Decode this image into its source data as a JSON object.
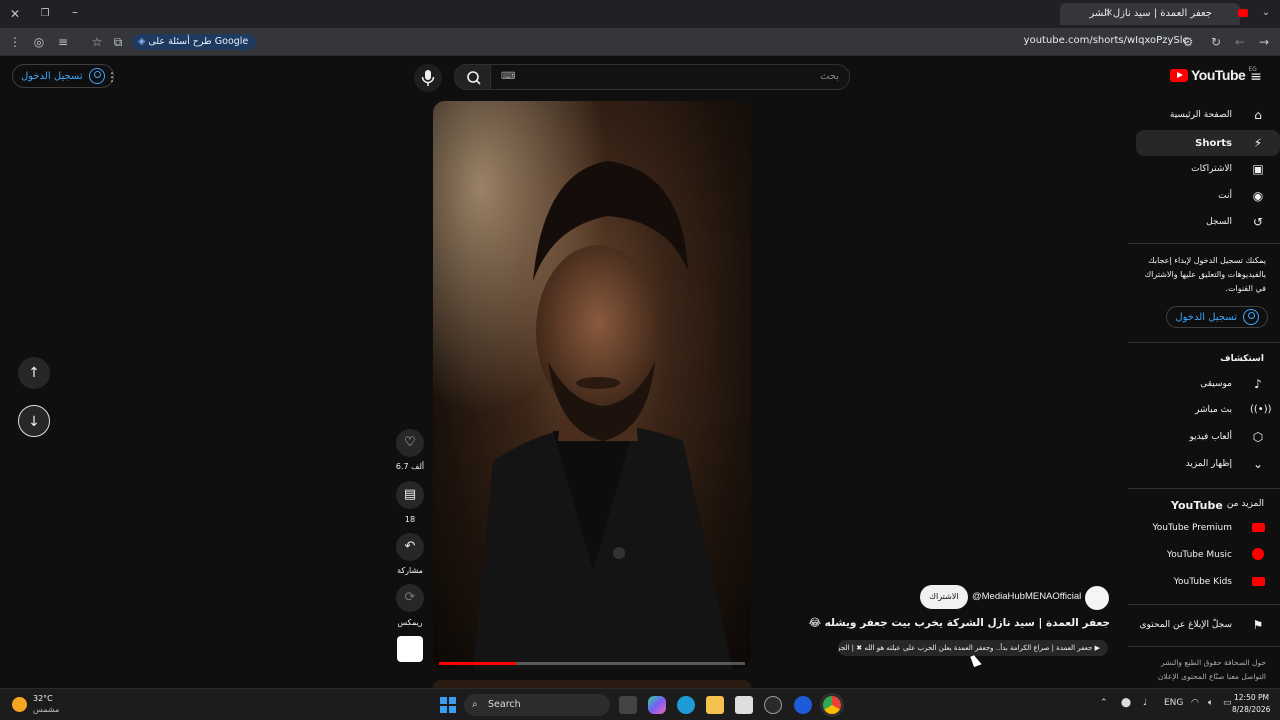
{
  "browser": {
    "tab_title": "جعفر العمدة | سيد نازل الشر",
    "chip_label": "طرح أسئلة على Google",
    "url": "youtube.com/shorts/wIqxoPzySlc"
  },
  "header": {
    "logo_text": "YouTube",
    "region": "EG",
    "search_placeholder": "بحث",
    "signin_label": "تسجيل الدخول"
  },
  "sidebar": {
    "items": [
      {
        "label": "الصفحة الرئيسية",
        "icon": "home-icon"
      },
      {
        "label": "Shorts",
        "icon": "shorts-icon"
      },
      {
        "label": "الاشتراكات",
        "icon": "subscriptions-icon"
      },
      {
        "label": "أنت",
        "icon": "you-icon"
      },
      {
        "label": "السجل",
        "icon": "history-icon"
      }
    ],
    "signin_prompt": "يمكنك تسجيل الدخول لإبداء إعجابك بالفيديوهات والتعليق عليها والاشتراك في القنوات.",
    "signin_label": "تسجيل الدخول",
    "explore_title": "استكشاف",
    "explore_items": [
      {
        "label": "موسيقى",
        "icon": "music-icon"
      },
      {
        "label": "بث مباشر",
        "icon": "live-icon"
      },
      {
        "label": "ألعاب فيديو",
        "icon": "gaming-icon"
      },
      {
        "label": "إظهار المزيد",
        "icon": "chevron-down-icon"
      }
    ],
    "more_title_prefix": "المزيد من",
    "more_title_brand": "YouTube",
    "more_items": [
      {
        "label": "YouTube Premium"
      },
      {
        "label": "YouTube Music"
      },
      {
        "label": "YouTube Kids"
      }
    ],
    "report_label": "سجلّ الإبلاغ عن المحتوى",
    "footer_line1": "حول  الصحافة  حقوق الطبع والنشر",
    "footer_line2": "التواصل معنا  صنّاع المحتوى  الإعلان"
  },
  "video": {
    "channel": "@MediaHubMENAOfficial",
    "subscribe_label": "الاشتراك",
    "title": "جعفر العمدة | سيد نازل الشركة يخرب بيت جعفر ويشله 😂",
    "playlist_text": "جعفر العمدة | صراع الكرامة بدأ.. وجعفر العمدة يعلن الحرب على عيلته هو الله ✖ | الجزء الثالث",
    "progress": 0.25
  },
  "actions": {
    "likes": "6.7 ألف",
    "comments": "18",
    "share": "مشاركة",
    "remix": "ريمكس"
  },
  "taskbar": {
    "weather_temp": "32°C",
    "weather_desc": "مشمس",
    "search_label": "Search",
    "lang": "ENG",
    "time": "12:50 PM",
    "date": "8/28/2026"
  }
}
